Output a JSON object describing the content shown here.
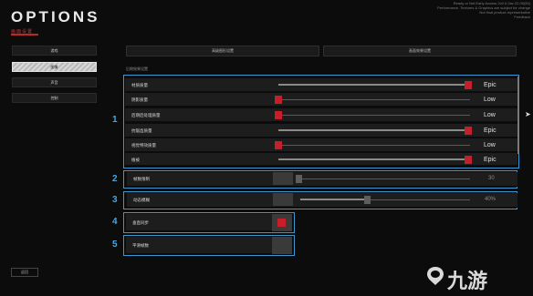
{
  "header": {
    "title": "OPTIONS",
    "subtitle": "画面设置",
    "build_lines": [
      "Ready or Not Early Access 2v0.0.2ac 22.05(50)",
      "Performance, Textures & Graphics are subject for change",
      "Not final product representative",
      "Feedback"
    ]
  },
  "left_menu": {
    "items": [
      {
        "label": "游戏"
      },
      {
        "label": "图像",
        "active": true
      },
      {
        "label": "声音"
      },
      {
        "label": "控制"
      }
    ],
    "back_label": "返回"
  },
  "tabs": [
    "高级图形设置",
    "画面效果设置"
  ],
  "section_header": "后期效果设置",
  "colors": {
    "accent_red": "#c61f2a",
    "group_blue": "#3f97d0",
    "number_blue": "#4aa6e2"
  },
  "groups": [
    {
      "number": "1",
      "rows": [
        {
          "label": "材质质量",
          "value": "Epic",
          "level": 1.0
        },
        {
          "label": "阴影质量",
          "value": "Low",
          "level": 0.0
        },
        {
          "label": "后期后处理质量",
          "value": "Low",
          "level": 0.0
        },
        {
          "label": "抗锯齿质量",
          "value": "Epic",
          "level": 1.0
        },
        {
          "label": "视觉特效质量",
          "value": "Low",
          "level": 0.0
        },
        {
          "label": "植被",
          "value": "Epic",
          "level": 1.0
        }
      ]
    },
    {
      "number": "2",
      "rows": [
        {
          "label": "帧数限制",
          "value": "30",
          "level": 0.0
        }
      ]
    },
    {
      "number": "3",
      "rows": [
        {
          "label": "动态模糊",
          "value": "40%",
          "level": 0.4
        }
      ]
    },
    {
      "number": "4",
      "rows": [
        {
          "label": "垂直同步",
          "checked": true
        }
      ]
    },
    {
      "number": "5",
      "rows": [
        {
          "label": "平滑帧数",
          "checked": false
        }
      ]
    }
  ],
  "watermark": {
    "text": "九游"
  }
}
